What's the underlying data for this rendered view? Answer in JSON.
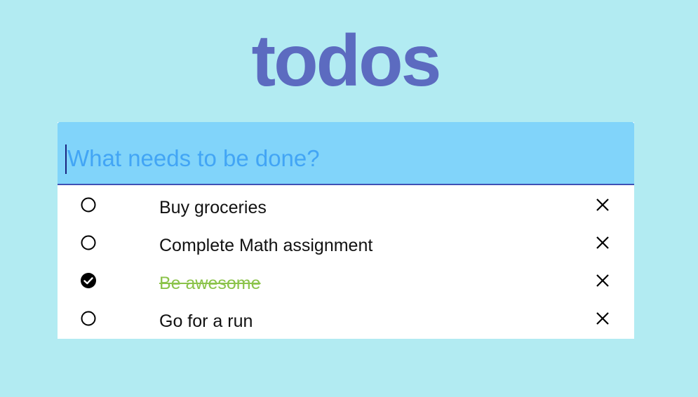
{
  "header": {
    "title": "todos"
  },
  "new_todo": {
    "placeholder": "What needs to be done?",
    "value": ""
  },
  "todos": [
    {
      "label": "Buy groceries",
      "completed": false
    },
    {
      "label": "Complete Math assignment",
      "completed": false
    },
    {
      "label": "Be awesome",
      "completed": true
    },
    {
      "label": "Go for a run",
      "completed": false
    }
  ],
  "icons": {
    "toggle_unchecked": "circle-outline-icon",
    "toggle_checked": "check-circle-icon",
    "delete": "close-icon"
  },
  "colors": {
    "background": "#b2ebf2",
    "title": "#5c6bc0",
    "input_bg": "#81d4fa",
    "placeholder": "#42a5f5",
    "input_underline": "#3f51b5",
    "completed_text": "#8bc34a"
  }
}
